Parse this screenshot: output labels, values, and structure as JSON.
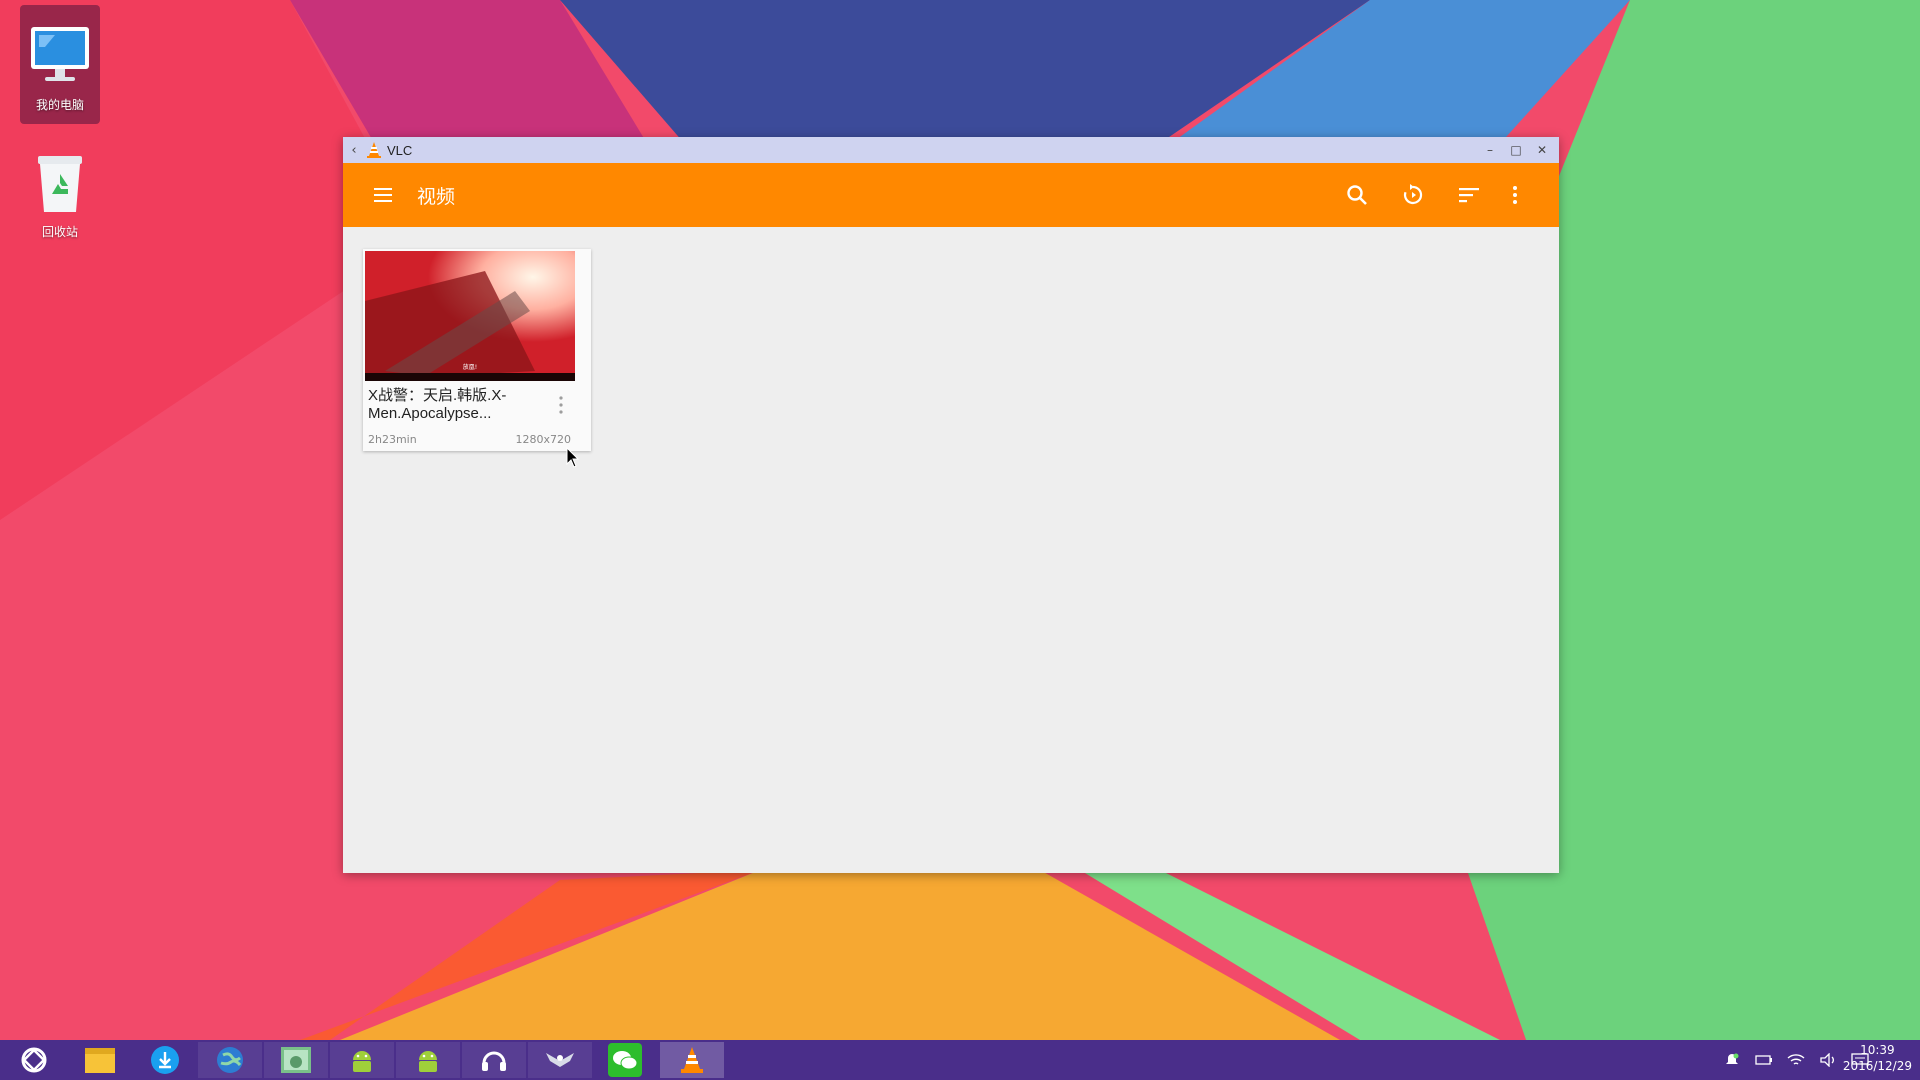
{
  "desktop": {
    "icons": [
      {
        "label": "我的电脑",
        "icon": "computer-icon",
        "selected": true
      },
      {
        "label": "回收站",
        "icon": "recycle-bin-icon",
        "selected": false
      }
    ]
  },
  "window": {
    "title": "VLC",
    "back_icon": "chevron-left-icon",
    "controls": [
      "minimize-icon",
      "maximize-icon",
      "close-icon"
    ]
  },
  "appbar": {
    "title": "视频",
    "menu_icon": "hamburger-menu-icon",
    "actions": [
      "search-icon",
      "refresh-icon",
      "sort-icon",
      "more-vert-icon"
    ],
    "color": "#ff8800"
  },
  "videos": [
    {
      "title": "X战警：天启.韩版.X-Men.Apocalypse...",
      "title_line1": "X战警：天启.韩版.X-",
      "title_line2": "Men.Apocalypse...",
      "thumb_caption": "放凰!",
      "duration": "2h23min",
      "resolution": "1280x720"
    }
  ],
  "taskbar": {
    "apps": [
      "start-icon",
      "file-manager-icon",
      "download-icon",
      "browser-icon",
      "gallery-icon",
      "android-icon",
      "android-icon",
      "headphones-app-icon",
      "eagle-app-icon",
      "wechat-icon",
      "vlc-icon"
    ],
    "tray": [
      "notification-icon",
      "battery-icon",
      "wifi-icon",
      "volume-icon",
      "message-icon"
    ],
    "time": "10:39",
    "date": "2016/12/29"
  }
}
